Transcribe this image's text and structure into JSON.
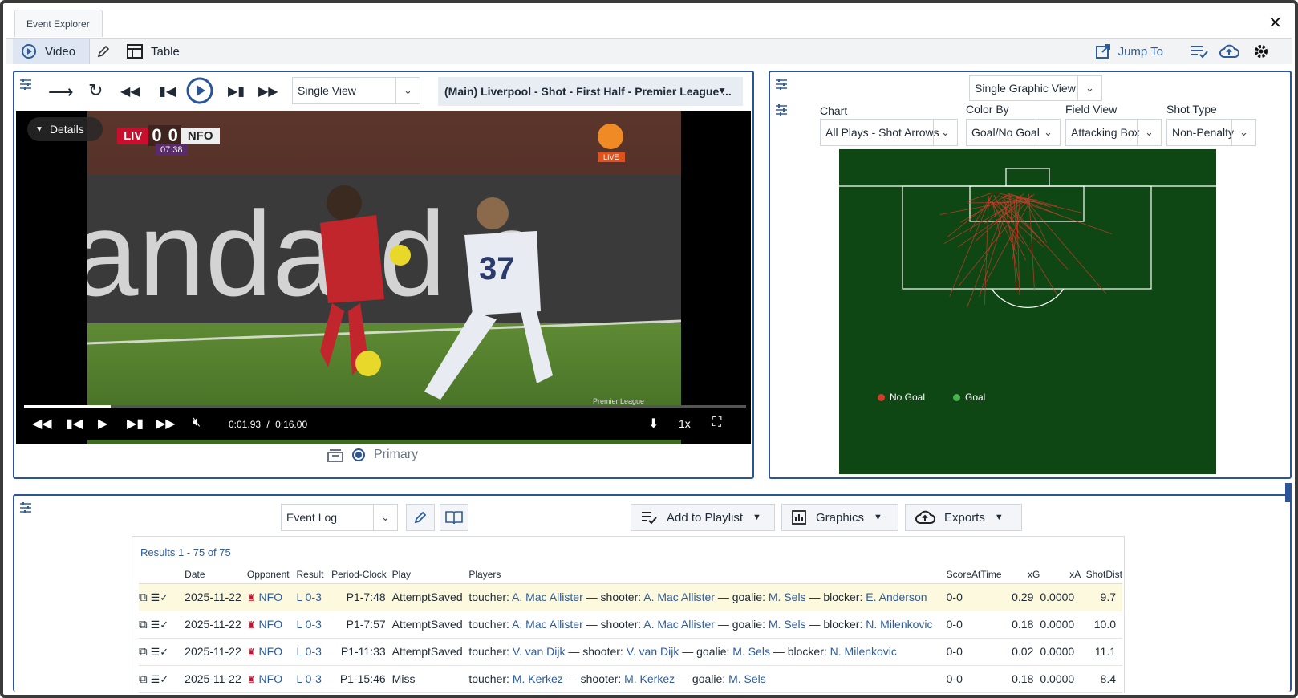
{
  "window": {
    "tab_title": "Event Explorer",
    "close_label": "✕"
  },
  "topbar": {
    "video_label": "Video",
    "table_label": "Table",
    "jump_label": "Jump To"
  },
  "video": {
    "view_select": "Single View",
    "clip_title": "(Main) Liverpool - Shot - First Half - Premier League ...",
    "details_label": "Details",
    "scorebug": {
      "home": "LIV",
      "home_score": "0",
      "away_score": "0",
      "away": "NFO",
      "clock": "07:38"
    },
    "broadcaster": "LIVE",
    "current_time": "0:01.93",
    "time_sep": "/",
    "duration": "0:16.00",
    "progress": 0.12,
    "speed": "1x",
    "source_label": "Primary",
    "watermark": "Premier League"
  },
  "chart_panel": {
    "graphic_view": "Single Graphic View",
    "chart_label": "Chart",
    "chart_value": "All Plays - Shot Arrows",
    "color_label": "Color By",
    "color_value": "Goal/No Goal",
    "field_label": "Field View",
    "field_value": "Attacking Box",
    "shot_label": "Shot Type",
    "shot_value": "Non-Penalty",
    "legend": [
      {
        "label": "No Goal",
        "color": "#d23b2a"
      },
      {
        "label": "Goal",
        "color": "#4caf50"
      }
    ],
    "pitch_color": "#0f4714"
  },
  "table_panel": {
    "log_select": "Event Log",
    "playlist_label": "Add to Playlist",
    "graphics_label": "Graphics",
    "exports_label": "Exports",
    "results": "Results 1 - 75 of 75",
    "columns": [
      "Date",
      "Opponent",
      "Result",
      "Period-Clock",
      "Play",
      "Players",
      "ScoreAtTime",
      "xG",
      "xA",
      "ShotDist"
    ],
    "rows": [
      {
        "date": "2025-11-22",
        "opp": "NFO",
        "result": "L 0-3",
        "clock": "P1-7:48",
        "play": "AttemptSaved",
        "players": [
          [
            "toucher: ",
            "A. Mac Allister"
          ],
          [
            " — shooter: ",
            "A. Mac Allister"
          ],
          [
            " — goalie: ",
            "M. Sels"
          ],
          [
            " — blocker: ",
            "E. Anderson"
          ]
        ],
        "score": "0-0",
        "xg": "0.29",
        "xa": "0.0000",
        "dist": "9.7"
      },
      {
        "date": "2025-11-22",
        "opp": "NFO",
        "result": "L 0-3",
        "clock": "P1-7:57",
        "play": "AttemptSaved",
        "players": [
          [
            "toucher: ",
            "A. Mac Allister"
          ],
          [
            " — shooter: ",
            "A. Mac Allister"
          ],
          [
            " — goalie: ",
            "M. Sels"
          ],
          [
            " — blocker: ",
            "N. Milenkovic"
          ]
        ],
        "score": "0-0",
        "xg": "0.18",
        "xa": "0.0000",
        "dist": "10.0"
      },
      {
        "date": "2025-11-22",
        "opp": "NFO",
        "result": "L 0-3",
        "clock": "P1-11:33",
        "play": "AttemptSaved",
        "players": [
          [
            "toucher: ",
            "V. van Dijk"
          ],
          [
            " — shooter: ",
            "V. van Dijk"
          ],
          [
            " — goalie: ",
            "M. Sels"
          ],
          [
            " — blocker: ",
            "N. Milenkovic"
          ]
        ],
        "score": "0-0",
        "xg": "0.02",
        "xa": "0.0000",
        "dist": "11.1"
      },
      {
        "date": "2025-11-22",
        "opp": "NFO",
        "result": "L 0-3",
        "clock": "P1-15:46",
        "play": "Miss",
        "players": [
          [
            "toucher: ",
            "M. Kerkez"
          ],
          [
            " — shooter: ",
            "M. Kerkez"
          ],
          [
            " — goalie: ",
            "M. Sels"
          ]
        ],
        "score": "0-0",
        "xg": "0.18",
        "xa": "0.0000",
        "dist": "8.4"
      }
    ]
  }
}
